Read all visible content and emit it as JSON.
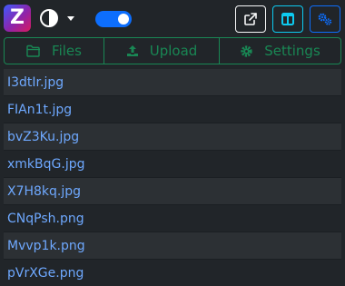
{
  "header": {
    "logo_letter": "Z",
    "theme_icon": "half-circle-icon",
    "dark_mode_switch_on": true,
    "buttons": [
      {
        "icon": "external-link-icon",
        "color": "#f8f9fa"
      },
      {
        "icon": "panel-layout-icon",
        "color": "#0dcaf0"
      },
      {
        "icon": "gears-icon",
        "color": "#0d6efd"
      }
    ]
  },
  "tabs": [
    {
      "label": "Files",
      "icon": "folder-icon"
    },
    {
      "label": "Upload",
      "icon": "upload-icon"
    },
    {
      "label": "Settings",
      "icon": "gear-icon"
    }
  ],
  "files": [
    "I3dtIr.jpg",
    "FIAn1t.jpg",
    "bvZ3Ku.jpg",
    "xmkBqG.jpg",
    "X7H8kq.jpg",
    "CNqPsh.png",
    "Mvvp1k.png",
    "pVrXGe.png"
  ],
  "colors": {
    "background": "#212529",
    "accent_green": "#198754",
    "link_blue": "#6ea8fe",
    "primary": "#0d6efd",
    "info": "#0dcaf0"
  }
}
